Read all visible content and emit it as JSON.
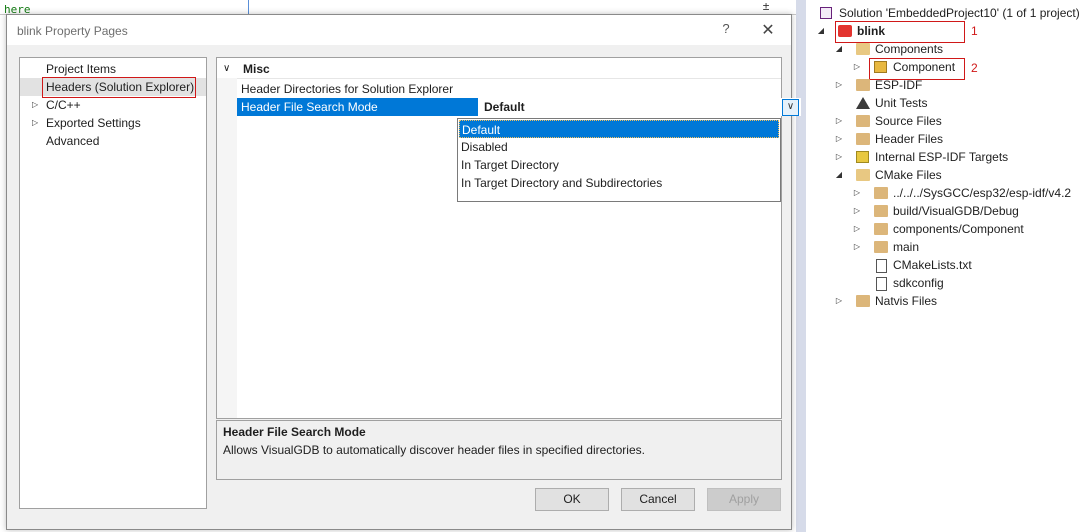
{
  "editor": {
    "code_line": "here",
    "scroll_symbol": "±"
  },
  "dialog": {
    "title": "blink Property Pages",
    "help_symbol": "?",
    "close_symbol": "✕",
    "nav": [
      {
        "label": "Project Items",
        "arrow": ""
      },
      {
        "label": "Headers (Solution Explorer)",
        "arrow": ""
      },
      {
        "label": "C/C++",
        "arrow": "▷"
      },
      {
        "label": "Exported Settings",
        "arrow": "▷"
      },
      {
        "label": "Advanced",
        "arrow": ""
      }
    ],
    "grid": {
      "category": "Misc",
      "category_chevron": "∨",
      "rows": [
        {
          "name": "Header Directories for Solution Explorer",
          "value": ""
        },
        {
          "name": "Header File Search Mode",
          "value": "Default"
        }
      ],
      "dropdown_arrow": "∨",
      "dropdown_options": [
        "Default",
        "Disabled",
        "In Target Directory",
        "In Target Directory and Subdirectories"
      ]
    },
    "description": {
      "title": "Header File Search Mode",
      "text": "Allows VisualGDB to automatically discover header files in specified directories."
    },
    "buttons": {
      "ok": "OK",
      "cancel": "Cancel",
      "apply": "Apply"
    }
  },
  "solution_explorer": {
    "items": [
      {
        "label": "Solution 'EmbeddedProject10' (1 of 1 project)",
        "arrow": ""
      },
      {
        "label": "blink",
        "arrow": "◢",
        "annotation": "1"
      },
      {
        "label": "Components",
        "arrow": "◢"
      },
      {
        "label": "Component",
        "arrow": "▷",
        "annotation": "2"
      },
      {
        "label": "ESP-IDF",
        "arrow": "▷"
      },
      {
        "label": "Unit Tests",
        "arrow": ""
      },
      {
        "label": "Source Files",
        "arrow": "▷"
      },
      {
        "label": "Header Files",
        "arrow": "▷"
      },
      {
        "label": "Internal ESP-IDF Targets",
        "arrow": "▷"
      },
      {
        "label": "CMake Files",
        "arrow": "◢"
      },
      {
        "label": "../../../SysGCC/esp32/esp-idf/v4.2",
        "arrow": "▷"
      },
      {
        "label": "build/VisualGDB/Debug",
        "arrow": "▷"
      },
      {
        "label": "components/Component",
        "arrow": "▷"
      },
      {
        "label": "main",
        "arrow": "▷"
      },
      {
        "label": "CMakeLists.txt",
        "arrow": ""
      },
      {
        "label": "sdkconfig",
        "arrow": ""
      },
      {
        "label": "Natvis Files",
        "arrow": "▷"
      }
    ]
  }
}
